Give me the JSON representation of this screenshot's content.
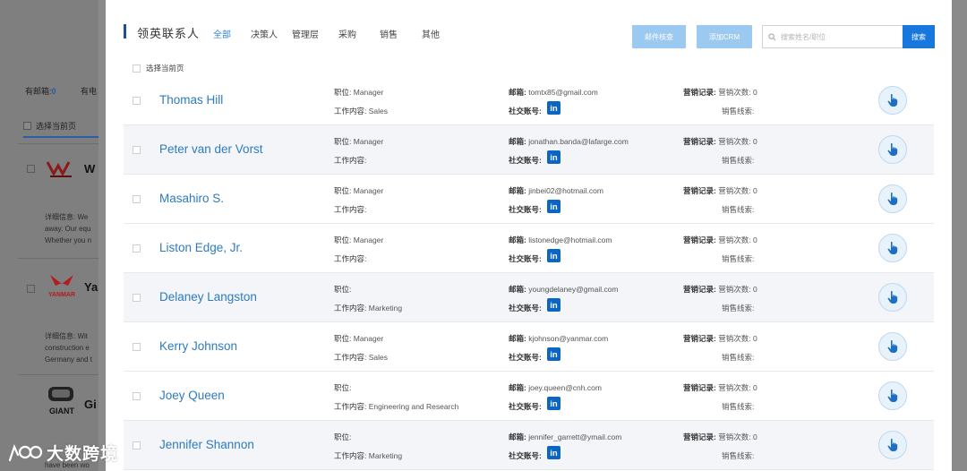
{
  "background": {
    "stat_email_label": "有邮箱:",
    "stat_email_value": "0",
    "stat_phone_label": "有电",
    "select_page": "选择当前页",
    "companies": [
      {
        "name": "W",
        "detail_label": "详细信息:",
        "detail_lines": [
          "We",
          "away. Our equ",
          "Whether you n"
        ]
      },
      {
        "name": "Ya",
        "detail_label": "详细信息:",
        "detail_lines": [
          "Wit",
          "construction e",
          "Germany and t"
        ]
      },
      {
        "name": "Gi",
        "detail_label": "",
        "detail_lines": [
          "have been wo"
        ]
      }
    ],
    "logo_texts": [
      "YANMAR",
      "GIANT"
    ]
  },
  "modal": {
    "title": "领英联系人",
    "tabs": [
      "全部",
      "决策人",
      "管理层",
      "采购",
      "销售",
      "其他"
    ],
    "active_tab": "全部",
    "buttons": {
      "email_verify": "邮件核查",
      "add_crm": "添加CRM",
      "search": "搜索"
    },
    "search_placeholder": "搜索姓名/职位",
    "select_page": "选择当前页",
    "labels": {
      "position": "职位:",
      "work": "工作内容:",
      "email": "邮箱:",
      "social": "社交账号:",
      "marketing": "营销记录:",
      "marketing_count": "营销次数:",
      "sales_leads": "销售线索:"
    },
    "contacts": [
      {
        "name": "Thomas Hill",
        "position": "Manager",
        "work": "Sales",
        "email": "tomtx85@gmail.com",
        "marketing_count": "0",
        "sales_leads": ""
      },
      {
        "name": "Peter van der Vorst",
        "position": "Manager",
        "work": "",
        "email": "jonathan.banda@lafarge.com",
        "marketing_count": "0",
        "sales_leads": ""
      },
      {
        "name": "Masahiro S.",
        "position": "Manager",
        "work": "",
        "email": "jinbei02@hotmail.com",
        "marketing_count": "0",
        "sales_leads": ""
      },
      {
        "name": "Liston Edge, Jr.",
        "position": "Manager",
        "work": "",
        "email": "listonedge@hotmail.com",
        "marketing_count": "0",
        "sales_leads": ""
      },
      {
        "name": "Delaney Langston",
        "position": "",
        "work": "Marketing",
        "email": "youngdelaney@gmail.com",
        "marketing_count": "0",
        "sales_leads": ""
      },
      {
        "name": "Kerry Johnson",
        "position": "Manager",
        "work": "Sales",
        "email": "kjohnson@yanmar.com",
        "marketing_count": "0",
        "sales_leads": ""
      },
      {
        "name": "Joey Queen",
        "position": "",
        "work": "Engineering and Research",
        "email": "joey.queen@cnh.com",
        "marketing_count": "0",
        "sales_leads": ""
      },
      {
        "name": "Jennifer Shannon",
        "position": "",
        "work": "Marketing",
        "email": "jennifer_garrett@ymail.com",
        "marketing_count": "0",
        "sales_leads": ""
      }
    ]
  },
  "watermark": "大数跨境",
  "colors": {
    "accent": "#2d86d6",
    "name_link": "#2e7bbf",
    "search_button": "#1877dd",
    "light_button": "#9cc9ef",
    "linkedin": "#0a66c2"
  },
  "icons": {
    "linkedin": "linkedin-icon",
    "contact": "contact-pointer-icon",
    "search": "search-icon",
    "watermark_logo": "watermark-logo-icon"
  }
}
